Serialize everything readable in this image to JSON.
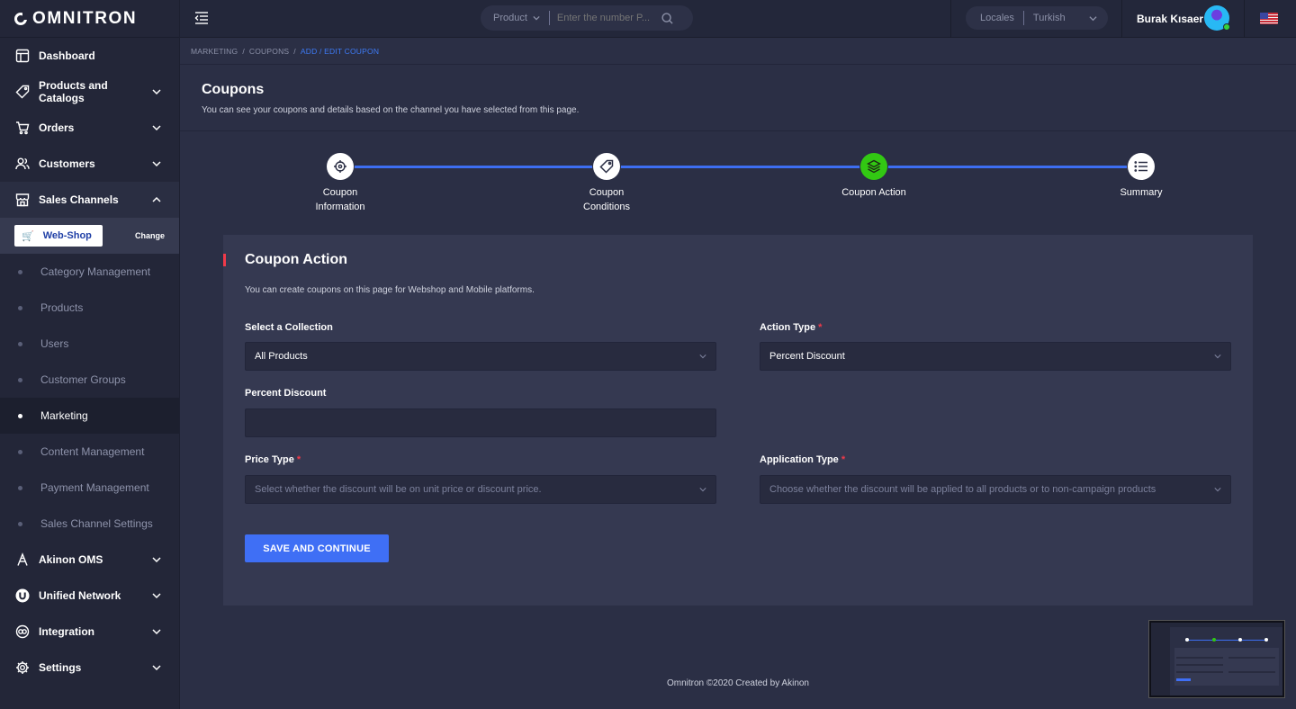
{
  "app": {
    "logo": "OMNITRON"
  },
  "sidebar": {
    "items_top": [
      {
        "label": "Dashboard",
        "icon": "dashboard-icon"
      },
      {
        "label": "Products and Catalogs",
        "icon": "tag-icon"
      },
      {
        "label": "Orders",
        "icon": "cart-icon"
      },
      {
        "label": "Customers",
        "icon": "users-icon"
      },
      {
        "label": "Sales Channels",
        "icon": "store-icon"
      }
    ],
    "channel": {
      "name": "Web-Shop",
      "change_label": "Change"
    },
    "sub_items": [
      "Category Management",
      "Products",
      "Users",
      "Customer Groups",
      "Marketing",
      "Content Management",
      "Payment Management",
      "Sales Channel Settings"
    ],
    "active_sub": "Marketing",
    "items_bottom": [
      {
        "label": "Akinon OMS",
        "icon": "oms-icon"
      },
      {
        "label": "Unified Network",
        "icon": "unified-network-icon"
      },
      {
        "label": "Integration",
        "icon": "integration-icon"
      },
      {
        "label": "Settings",
        "icon": "gear-icon"
      }
    ]
  },
  "header": {
    "search": {
      "scope": "Product",
      "placeholder": "Enter the number P..."
    },
    "locales": {
      "label": "Locales",
      "value": "Turkish"
    },
    "user": {
      "name": "Burak Kısaer"
    }
  },
  "breadcrumb": [
    "MARKETING",
    "COUPONS",
    "ADD / EDIT COUPON"
  ],
  "page": {
    "title": "Coupons",
    "subtitle": "You can see your coupons and details based on the channel you have selected from this page."
  },
  "stepper": {
    "steps": [
      {
        "label_line1": "Coupon",
        "label_line2": "Information",
        "icon": "target-icon"
      },
      {
        "label_line1": "Coupon",
        "label_line2": "Conditions",
        "icon": "tag-icon"
      },
      {
        "label_line1": "Coupon Action",
        "label_line2": "",
        "icon": "layers-icon"
      },
      {
        "label_line1": "Summary",
        "label_line2": "",
        "icon": "list-icon"
      }
    ],
    "active_index": 2
  },
  "form": {
    "title": "Coupon Action",
    "description": "You can create coupons on this page for Webshop and Mobile platforms.",
    "collection": {
      "label": "Select a Collection",
      "value": "All Products"
    },
    "action_type": {
      "label": "Action Type",
      "value": "Percent Discount"
    },
    "percent_discount": {
      "label": "Percent Discount",
      "value": ""
    },
    "price_type": {
      "label": "Price Type",
      "placeholder": "Select whether the discount will be on unit price or discount price."
    },
    "application_type": {
      "label": "Application Type",
      "placeholder": "Choose whether the discount will be applied to all products or to non-campaign products"
    },
    "required_mark": "*",
    "save_label": "SAVE AND CONTINUE"
  },
  "footer": {
    "text": "Omnitron ©2020 Created by Akinon"
  },
  "colors": {
    "accent": "#3f6ff5",
    "active_step": "#32c813",
    "required": "#f03a4a",
    "sidebar_bg": "#232638",
    "page_bg": "#2b2f45"
  }
}
